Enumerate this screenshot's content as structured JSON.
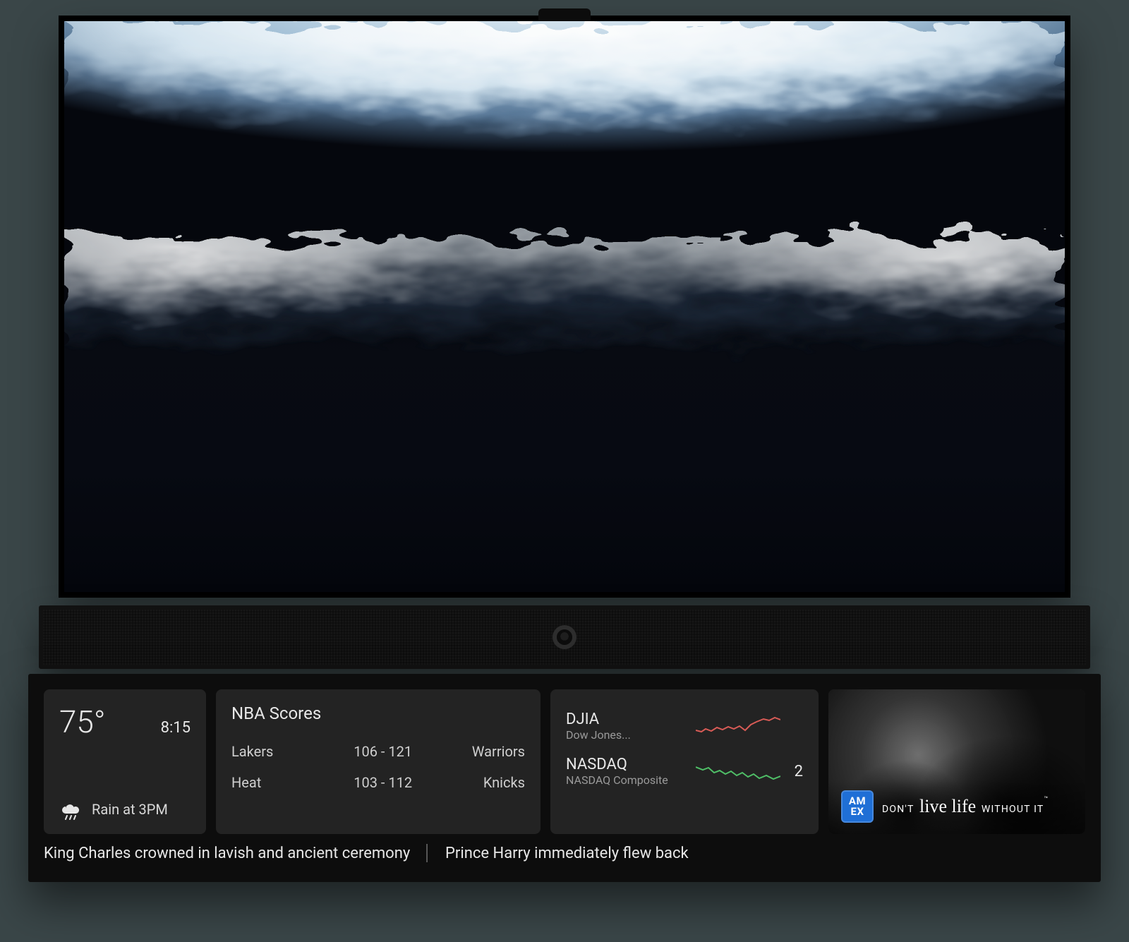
{
  "wallpaper": {
    "description": "aerial-ocean-waves"
  },
  "weather": {
    "temperature": "75°",
    "time": "8:15",
    "icon": "rain-cloud-icon",
    "summary": "Rain at 3PM"
  },
  "scores": {
    "title": "NBA Scores",
    "games": [
      {
        "team1": "Lakers",
        "score": "106 - 121",
        "team2": "Warriors"
      },
      {
        "team1": "Heat",
        "score": "103 - 112",
        "team2": "Knicks"
      }
    ]
  },
  "stocks": {
    "items": [
      {
        "symbol": "DJIA",
        "name": "Dow Jones...",
        "trend": "down",
        "color": "#d85b56",
        "value_preview": ""
      },
      {
        "symbol": "NASDAQ",
        "name": "NASDAQ Composite",
        "trend": "up",
        "color": "#4fbf67",
        "value_preview": "2"
      }
    ]
  },
  "ad": {
    "brand_badge": "AM EX",
    "tagline_prefix": "DON'T ",
    "tagline_accent": "live life",
    "tagline_suffix": " WITHOUT IT",
    "trademark": "™"
  },
  "ticker": {
    "items": [
      "King Charles crowned in lavish and ancient ceremony",
      "Prince Harry immediately flew back"
    ]
  }
}
